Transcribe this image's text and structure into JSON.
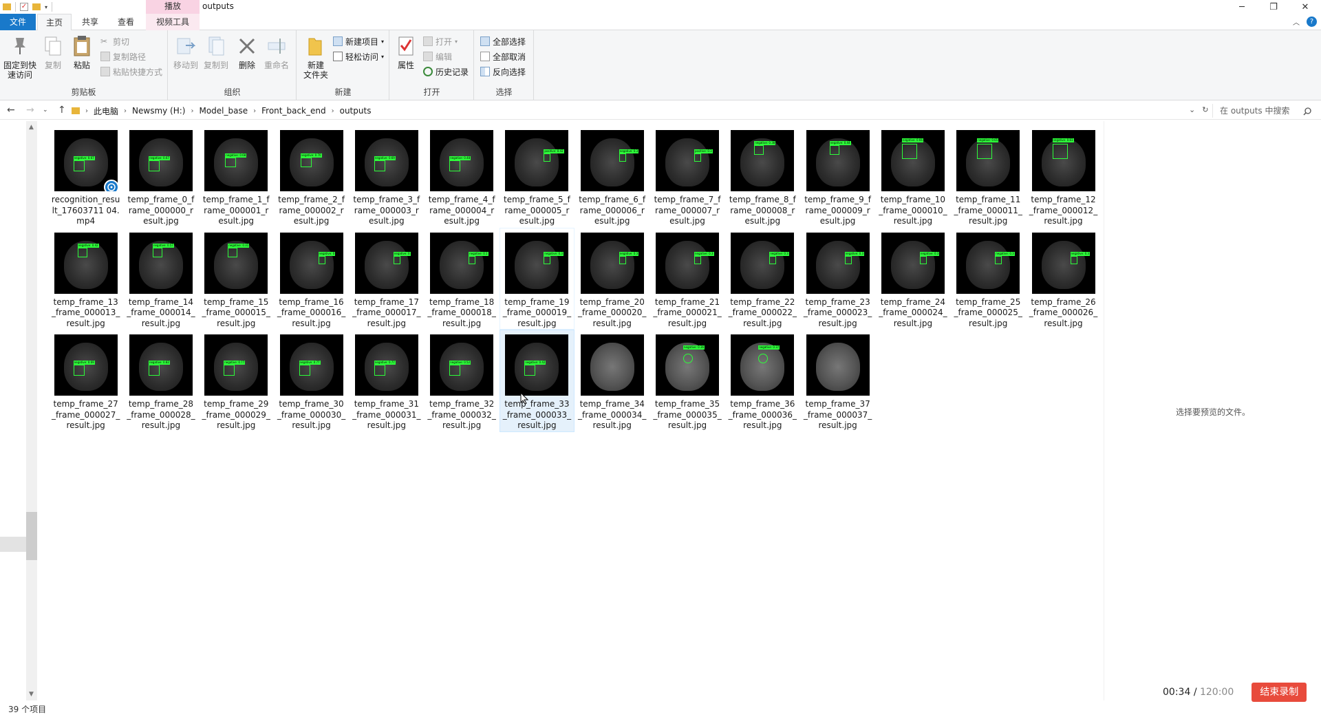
{
  "window": {
    "title": "outputs",
    "context_tab": "播放"
  },
  "tabs": {
    "file": "文件",
    "home": "主页",
    "share": "共享",
    "view": "查看",
    "video_tools": "视频工具"
  },
  "ribbon": {
    "clipboard": {
      "label": "剪贴板",
      "pin": "固定到快\n速访问",
      "copy": "复制",
      "paste": "粘贴",
      "cut": "剪切",
      "copy_path": "复制路径",
      "paste_shortcut": "粘贴快捷方式"
    },
    "organize": {
      "label": "组织",
      "move_to": "移动到",
      "copy_to": "复制到",
      "delete": "删除",
      "rename": "重命名"
    },
    "new": {
      "label": "新建",
      "new_folder": "新建\n文件夹",
      "new_item": "新建项目",
      "easy_access": "轻松访问"
    },
    "open": {
      "label": "打开",
      "properties": "属性",
      "open": "打开",
      "edit": "编辑",
      "history": "历史记录"
    },
    "select": {
      "label": "选择",
      "select_all": "全部选择",
      "select_none": "全部取消",
      "invert": "反向选择"
    }
  },
  "address": {
    "crumbs": [
      "此电脑",
      "Newsmy (H:)",
      "Model_base",
      "Front_back_end",
      "outputs"
    ],
    "search_placeholder": "在 outputs 中搜索"
  },
  "files": [
    {
      "name": "recognition_result_17603711 04.mp4",
      "label": "negative: 0.67",
      "box": "low"
    },
    {
      "name": "temp_frame_0_frame_000000_result.jpg",
      "label": "negative: 0.67",
      "box": "low"
    },
    {
      "name": "temp_frame_1_frame_000001_result.jpg",
      "label": "negative: 0.68",
      "box": "mid"
    },
    {
      "name": "temp_frame_2_frame_000002_result.jpg",
      "label": "negative: 0.70",
      "box": "mid"
    },
    {
      "name": "temp_frame_3_frame_000003_result.jpg",
      "label": "negative: 0.69",
      "box": "low"
    },
    {
      "name": "temp_frame_4_frame_000004_result.jpg",
      "label": "negative: 0.48",
      "box": "low"
    },
    {
      "name": "temp_frame_5_frame_000005_result.jpg",
      "label": "positive: 0.42",
      "box": "right"
    },
    {
      "name": "temp_frame_6_frame_000006_result.jpg",
      "label": "negative: 0.3",
      "box": "right"
    },
    {
      "name": "temp_frame_7_frame_000007_result.jpg",
      "label": "positive: 0.3",
      "box": "right"
    },
    {
      "name": "temp_frame_8_frame_000008_result.jpg",
      "label": "negative: 0.38",
      "box": "top"
    },
    {
      "name": "temp_frame_9_frame_000009_result.jpg",
      "label": "negative: 0.44",
      "box": "top"
    },
    {
      "name": "temp_frame_10_frame_000010_result.jpg",
      "label": "negative: 0.66",
      "box": "topbig"
    },
    {
      "name": "temp_frame_11_frame_000011_result.jpg",
      "label": "negative: 0.65",
      "box": "topbig"
    },
    {
      "name": "temp_frame_12_frame_000012_result.jpg",
      "label": "negative: 0.83",
      "box": "topbig"
    },
    {
      "name": "temp_frame_13_frame_000013_result.jpg",
      "label": "negative: 0.42",
      "box": "top"
    },
    {
      "name": "temp_frame_14_frame_000014_result.jpg",
      "label": "negative: 0.57",
      "box": "top"
    },
    {
      "name": "temp_frame_15_frame_000015_result.jpg",
      "label": "negative: 0.31",
      "box": "top"
    },
    {
      "name": "temp_frame_16_frame_000016_result.jpg",
      "label": "negative: 0",
      "box": "right"
    },
    {
      "name": "temp_frame_17_frame_000017_result.jpg",
      "label": "negative: 0",
      "box": "right"
    },
    {
      "name": "temp_frame_18_frame_000018_result.jpg",
      "label": "negative: 0.1",
      "box": "right"
    },
    {
      "name": "temp_frame_19_frame_000019_result.jpg",
      "label": "negative: 0.3",
      "box": "right"
    },
    {
      "name": "temp_frame_20_frame_000020_result.jpg",
      "label": "negative: 0.3",
      "box": "right"
    },
    {
      "name": "temp_frame_21_frame_000021_result.jpg",
      "label": "negative: 0.3",
      "box": "right"
    },
    {
      "name": "temp_frame_22_frame_000022_result.jpg",
      "label": "negative: 0.3",
      "box": "right"
    },
    {
      "name": "temp_frame_23_frame_000023_result.jpg",
      "label": "negative: 0.3",
      "box": "right"
    },
    {
      "name": "temp_frame_24_frame_000024_result.jpg",
      "label": "negative: 0.3",
      "box": "right"
    },
    {
      "name": "temp_frame_25_frame_000025_result.jpg",
      "label": "negative: 0.3",
      "box": "right"
    },
    {
      "name": "temp_frame_26_frame_000026_result.jpg",
      "label": "negative: 0.3",
      "box": "right"
    },
    {
      "name": "temp_frame_27_frame_000027_result.jpg",
      "label": "negative: 0.69",
      "box": "low"
    },
    {
      "name": "temp_frame_28_frame_000028_result.jpg",
      "label": "negative: 0.82",
      "box": "low"
    },
    {
      "name": "temp_frame_29_frame_000029_result.jpg",
      "label": "negative: 0.77",
      "box": "low"
    },
    {
      "name": "temp_frame_30_frame_000030_result.jpg",
      "label": "negative: 0.77",
      "box": "low"
    },
    {
      "name": "temp_frame_31_frame_000031_result.jpg",
      "label": "negative: 0.77",
      "box": "low"
    },
    {
      "name": "temp_frame_32_frame_000032_result.jpg",
      "label": "negative: 0.52",
      "box": "low"
    },
    {
      "name": "temp_frame_33_frame_000033_result.jpg",
      "label": "negative: 0.42",
      "box": "low"
    },
    {
      "name": "temp_frame_34_frame_000034_result.jpg",
      "label": "",
      "box": "none"
    },
    {
      "name": "temp_frame_35_frame_000035_result.jpg",
      "label": "negative: 0.36",
      "box": "ring"
    },
    {
      "name": "temp_frame_36_frame_000036_result.jpg",
      "label": "negative: 0.37",
      "box": "ring"
    },
    {
      "name": "temp_frame_37_frame_000037_result.jpg",
      "label": "",
      "box": "none"
    }
  ],
  "preview": {
    "empty_text": "选择要预览的文件。"
  },
  "status": {
    "item_count": "39 个项目"
  },
  "recorder": {
    "elapsed": "00:34",
    "separator": "/",
    "max": "120:00",
    "stop_label": "结束录制"
  },
  "colors": {
    "accent": "#1979ca",
    "bbox": "#2dff3a",
    "record": "#e84b3c",
    "context_tab": "#f9d3e3"
  }
}
